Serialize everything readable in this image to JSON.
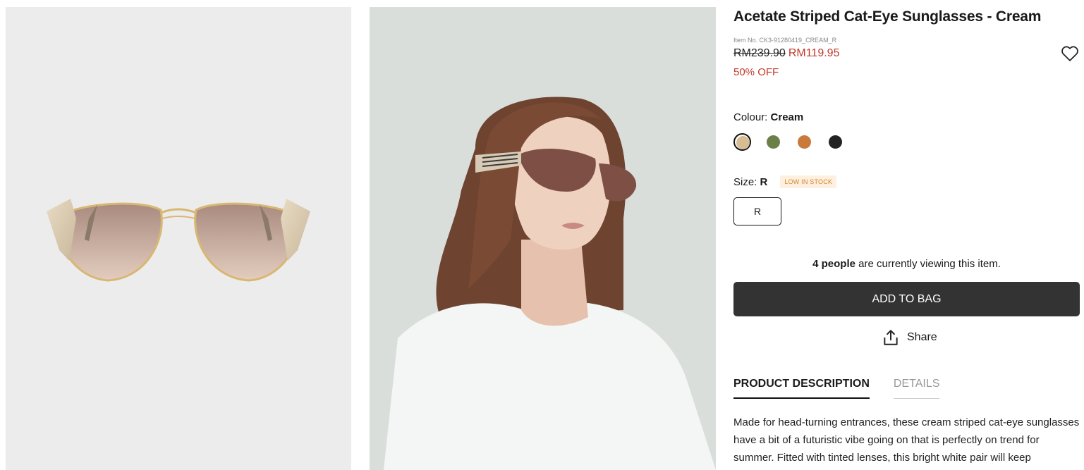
{
  "product": {
    "title": "Acetate Striped Cat-Eye Sunglasses - Cream",
    "item_no": "Item No. CK3-91280419_CREAM_R",
    "old_price": "RM239.90",
    "new_price": "RM119.95",
    "discount": "50% OFF"
  },
  "colour": {
    "label": "Colour:",
    "selected": "Cream",
    "swatches": [
      {
        "name": "Cream",
        "color": "#d7bd94",
        "selected": true
      },
      {
        "name": "Green",
        "color": "#6b8049"
      },
      {
        "name": "Orange",
        "color": "#c97a3b"
      },
      {
        "name": "Black",
        "color": "#222222"
      }
    ]
  },
  "size": {
    "label": "Size:",
    "selected": "R",
    "stock_badge": "LOW IN STOCK",
    "options": [
      "R"
    ]
  },
  "viewing": {
    "count": "4 people",
    "text": " are currently viewing this item."
  },
  "actions": {
    "add_to_bag": "ADD TO BAG",
    "share": "Share"
  },
  "tabs": [
    {
      "label": "PRODUCT DESCRIPTION",
      "active": true
    },
    {
      "label": "DETAILS",
      "active": false
    }
  ],
  "description": "Made for head-turning entrances, these cream striped cat-eye sunglasses have a bit of a futuristic vibe going on that is perfectly on trend for summer. Fitted with tinted lenses, this bright white pair will keep",
  "icons": {
    "wishlist": "heart-icon",
    "share": "share-icon"
  }
}
